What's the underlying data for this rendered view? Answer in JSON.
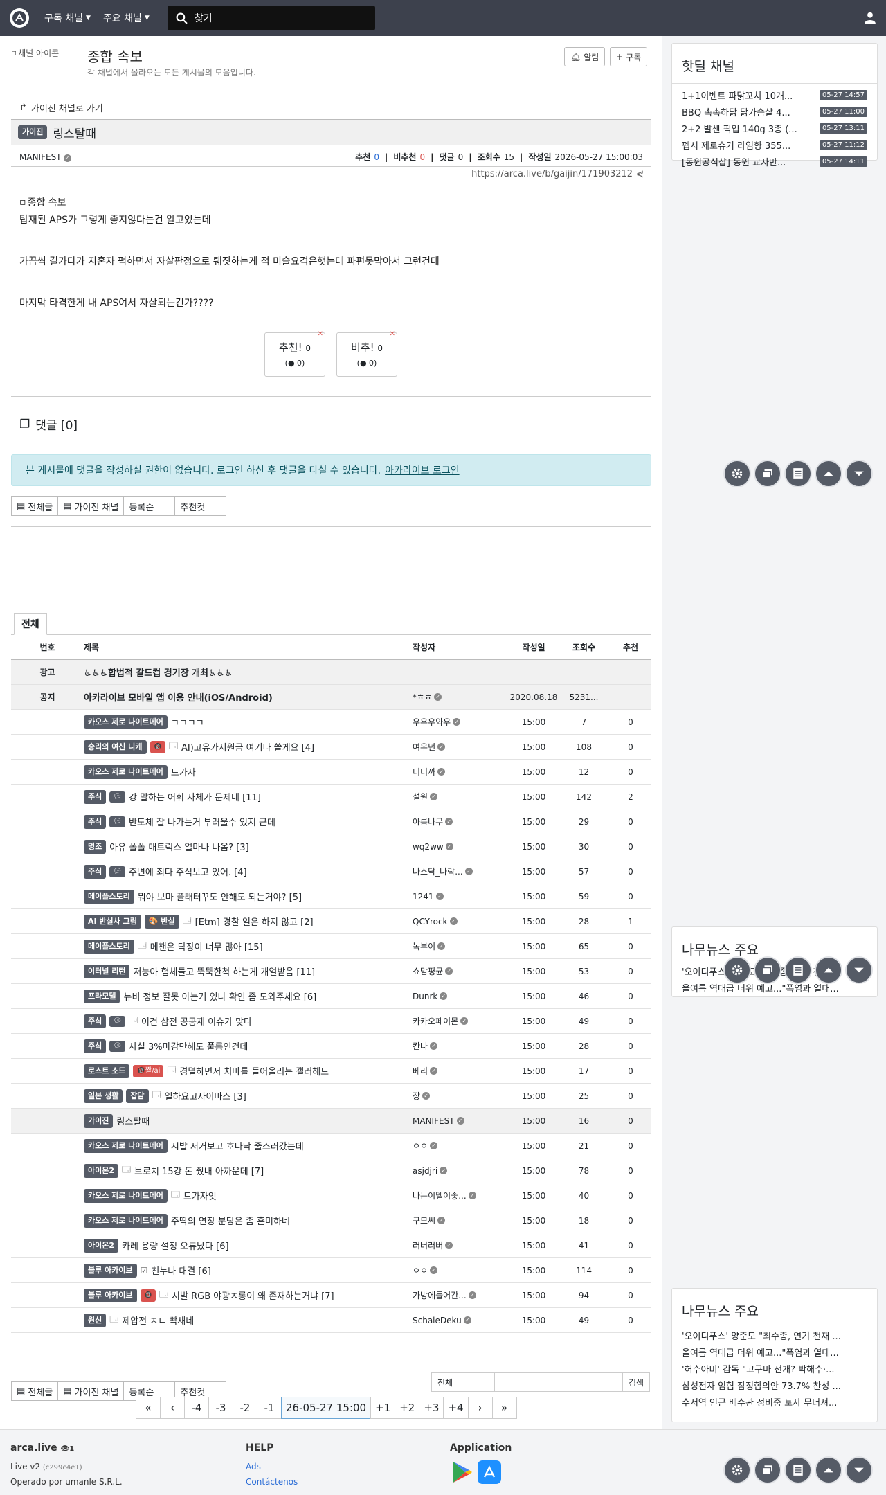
{
  "nav": {
    "menu1": "구독 채널",
    "menu2": "주요 채널",
    "search_placeholder": "찾기"
  },
  "board": {
    "icon_alt": "채널 아이콘",
    "title": "종합 속보",
    "description": "각 채널에서 올라오는 모든 게시물의 모음입니다.",
    "alarm_label": "알림",
    "subscribe_label": "구독"
  },
  "article": {
    "back_link": "가이진 채널로 가기",
    "category": "가이진",
    "title": "링스탈때",
    "author": "MANIFEST",
    "rec_label": "추천",
    "rec": "0",
    "unrec_label": "비추천",
    "unrec": "0",
    "comments_label": "댓글",
    "comments": "0",
    "views_label": "조회수",
    "views": "15",
    "date_label": "작성일",
    "date": "2026-05-27 15:00:03",
    "url": "https://arca.live/b/gaijin/171903212",
    "image_alt": "종합 속보",
    "lines": [
      "탑재된 APS가 그렇게 좋지않다는건 알고있는데",
      "",
      "가끔씩 길가다가 지혼자 퍽하면서 자살판정으로 퉤짓하는게 적 미슬요격은햇는데 파편못막아서 그런건데",
      "",
      "마지막 타격한게 내 APS여서 자살되는건가????"
    ],
    "vote_up_label": "추천!",
    "vote_up": "0",
    "vote_up_sub": "0",
    "vote_down_label": "비추!",
    "vote_down": "0",
    "vote_down_sub": "0"
  },
  "comments": {
    "header": "댓글 [0]",
    "alert": "본 게시물에 댓글을 작성하실 권한이 없습니다. 로그인 하신 후 댓글을 다실 수 있습니다.",
    "login_link": "아카라이브 로그인"
  },
  "filters": [
    "전체글",
    "가이진 채널",
    "등록순",
    "추천컷"
  ],
  "list": {
    "tab": "전체",
    "headers": {
      "num": "번호",
      "title": "제목",
      "author": "작성자",
      "date": "작성일",
      "views": "조회수",
      "rate": "추천"
    },
    "rows": [
      {
        "num": "광고",
        "title": "♿♿♿합법적 갈드컵 경기장 개최♿♿♿",
        "author": "",
        "date": "",
        "views": "",
        "rate": "",
        "bold": true,
        "gray": true
      },
      {
        "num": "공지",
        "title": "아카라이브 모바일 앱 이용 안내(iOS/Android)",
        "author": "*ㅎㅎ",
        "date": "2020.08.18",
        "views": "5231...",
        "rate": "",
        "bold": true,
        "gray": true
      },
      {
        "num": "",
        "badge": "카오스 제로 나이트메어",
        "title": "ㄱㄱㄱㄱ",
        "author": "우우우와우",
        "date": "15:00",
        "views": "7",
        "rate": "0"
      },
      {
        "num": "",
        "badge": "승리의 여신 니케",
        "red": "🔞",
        "img": true,
        "title": "AI)고유가지원금 여기다 쓸게요 [4]",
        "author": "여우년",
        "date": "15:00",
        "views": "108",
        "rate": "0"
      },
      {
        "num": "",
        "badge": "카오스 제로 나이트메어",
        "title": "드가자",
        "author": "니니까",
        "date": "15:00",
        "views": "12",
        "rate": "0"
      },
      {
        "num": "",
        "badge": "주식",
        "cmt": true,
        "title": "강 말하는 어휘 자체가 문제네 [11]",
        "author": "설원",
        "date": "15:00",
        "views": "142",
        "rate": "2"
      },
      {
        "num": "",
        "badge": "주식",
        "cmt": true,
        "title": "반도체 잘 나가는거 부러울수 있지 근데",
        "author": "아름나무",
        "date": "15:00",
        "views": "29",
        "rate": "0"
      },
      {
        "num": "",
        "badge": "명조",
        "title": "아유 폴폴 매트릭스 얼마나 나옴? [3]",
        "author": "wq2ww",
        "date": "15:00",
        "views": "30",
        "rate": "0"
      },
      {
        "num": "",
        "badge": "주식",
        "cmt": true,
        "title": "주변에 죄다 주식보고 있어. [4]",
        "author": "나스닥_나락...",
        "date": "15:00",
        "views": "57",
        "rate": "0"
      },
      {
        "num": "",
        "badge": "메이플스토리",
        "title": "뭐야 보마 플래터꾸도 안해도 되는거야? [5]",
        "author": "1241",
        "date": "15:00",
        "views": "59",
        "rate": "0"
      },
      {
        "num": "",
        "badge": "AI 반실사 그림",
        "badge2": "🎨 반실",
        "img": true,
        "title": "[Etm] 경찰 일은 하지 않고 [2]",
        "author": "QCYrock",
        "date": "15:00",
        "views": "28",
        "rate": "1"
      },
      {
        "num": "",
        "badge": "메이플스토리",
        "img": true,
        "title": "메챈은 닥장이 너무 많아 [15]",
        "author": "녹부이",
        "date": "15:00",
        "views": "65",
        "rate": "0"
      },
      {
        "num": "",
        "badge": "이터널 리턴",
        "title": "저능아 험체들고 뚝뚝한척 하는게 개얼받음 [11]",
        "author": "쇼맘평균",
        "date": "15:00",
        "views": "53",
        "rate": "0"
      },
      {
        "num": "",
        "badge": "프라모델",
        "title": "뉴비 정보 잘못 아는거 있나 확인 좀 도와주세요 [6]",
        "author": "Dunrk",
        "date": "15:00",
        "views": "46",
        "rate": "0"
      },
      {
        "num": "",
        "badge": "주식",
        "cmt": true,
        "img": true,
        "title": "이건 삼전 공공재 이슈가 맞다",
        "author": "카카오페이몬",
        "date": "15:00",
        "views": "49",
        "rate": "0"
      },
      {
        "num": "",
        "badge": "주식",
        "cmt": true,
        "title": "사실 3%마감만해도 풀롱인건데",
        "author": "칸나",
        "date": "15:00",
        "views": "28",
        "rate": "0"
      },
      {
        "num": "",
        "badge": "로스트 소드",
        "red": "🔞짤/ai",
        "img": true,
        "title": "경멸하면서 치마를 들어올리는 갤러해드",
        "author": "베리",
        "date": "15:00",
        "views": "17",
        "rate": "0"
      },
      {
        "num": "",
        "badge": "일본 생활",
        "badge2": "잡담",
        "img": true,
        "title": "일하요고자이마스 [3]",
        "author": "장",
        "date": "15:00",
        "views": "25",
        "rate": "0"
      },
      {
        "num": "",
        "badge": "가이진",
        "title": "링스탈때",
        "author": "MANIFEST",
        "date": "15:00",
        "views": "16",
        "rate": "0",
        "gray": true
      },
      {
        "num": "",
        "badge": "카오스 제로 나이트메어",
        "title": "시발 저거보고 호다닥 줄스러갔는데",
        "author": "ㅇㅇ",
        "date": "15:00",
        "views": "21",
        "rate": "0"
      },
      {
        "num": "",
        "badge": "아이온2",
        "img": true,
        "title": "브로치 15강 돈 줬내 아까운데 [7]",
        "author": "asjdjri",
        "date": "15:00",
        "views": "78",
        "rate": "0"
      },
      {
        "num": "",
        "badge": "카오스 제로 나이트메어",
        "img": true,
        "title": "드가자잇",
        "author": "나는이델이좋...",
        "date": "15:00",
        "views": "40",
        "rate": "0"
      },
      {
        "num": "",
        "badge": "카오스 제로 나이트메어",
        "title": "주딱의 연장 분탕은 좀 혼미하네",
        "author": "구모씨",
        "date": "15:00",
        "views": "18",
        "rate": "0"
      },
      {
        "num": "",
        "badge": "아이온2",
        "title": "카레 용량 설정 오류났다 [6]",
        "author": "러버러버",
        "date": "15:00",
        "views": "41",
        "rate": "0"
      },
      {
        "num": "",
        "badge": "블루 아카이브",
        "chk": true,
        "title": "친누나 대결 [6]",
        "author": "ㅇㅇ",
        "date": "15:00",
        "views": "114",
        "rate": "0"
      },
      {
        "num": "",
        "badge": "블루 아카이브",
        "red": "🔞",
        "img": true,
        "title": "시발 RGB 야광ㅈ롱이 왜 존재하는거냐 [7]",
        "author": "가방에들어간...",
        "date": "15:00",
        "views": "94",
        "rate": "0"
      },
      {
        "num": "",
        "badge": "원신",
        "img": true,
        "title": "제압전 ㅈㄴ 빡새네",
        "author": "SchaleDeku",
        "date": "15:00",
        "views": "49",
        "rate": "0"
      }
    ]
  },
  "search": {
    "scope": "전체",
    "button": "검색"
  },
  "pager": [
    "«",
    "‹",
    "-4",
    "-3",
    "-2",
    "-1",
    "26-05-27 15:00",
    "+1",
    "+2",
    "+3",
    "+4",
    "›",
    "»"
  ],
  "sidebar": {
    "hotdeal_title": "핫딜 채널",
    "hotdeals": [
      {
        "title": "1+1이벤트 파닭꼬치 10개...",
        "date": "05-27 14:57"
      },
      {
        "title": "BBQ 촉촉하닭 닭가슴살 4...",
        "date": "05-27 11:00"
      },
      {
        "title": "2+2 발센 픽업 140g 3종 (...",
        "date": "05-27 13:11"
      },
      {
        "title": "펩시 제로슈거 라임향 355...",
        "date": "05-27 11:12"
      },
      {
        "title": "[동원공식샵] 동원 교자만...",
        "date": "05-27 14:11"
      }
    ],
    "news_title": "나무뉴스 주요",
    "news_mid": [
      "'오이디푸스' 양준모 \"최수종, 연기 천재 ...",
      "올여름 역대급 더위 예고...\"폭염과 열대..."
    ],
    "news": [
      "'오이디푸스' 양준모 \"최수종, 연기 천재 ...",
      "올여름 역대급 더위 예고...\"폭염과 열대...",
      "'허수아비' 감독 \"고구마 전개? 박해수·...",
      "삼성전자 임협 잠정합의안 73.7% 찬성 ...",
      "수서역 인근 배수관 정비중 토사 무너져..."
    ]
  },
  "footer": {
    "brand": "arca.live",
    "brand_badge": "1",
    "version": "Live v2",
    "version_hash": "(c299c4e1)",
    "operator": "Operado por umanle S.R.L.",
    "help_title": "HELP",
    "help_ads": "Ads",
    "help_contact": "Contáctenos",
    "app_title": "Application"
  }
}
